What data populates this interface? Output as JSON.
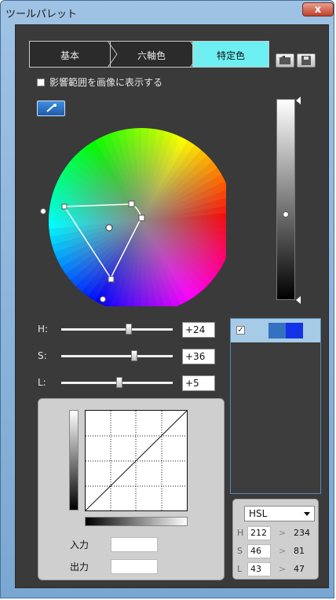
{
  "window": {
    "title": "ツールパレット",
    "close_symbol": "x"
  },
  "tabs": [
    {
      "label": "基本",
      "active": false
    },
    {
      "label": "六軸色",
      "active": false
    },
    {
      "label": "特定色",
      "active": true
    }
  ],
  "toolbar": {
    "load_icon": "folder-open-icon",
    "save_icon": "floppy-disk-icon"
  },
  "options": {
    "show_range_label": "影響範囲を画像に表示する",
    "show_range_checked": false,
    "eyedropper_icon": "eyedropper-icon"
  },
  "sliders": [
    {
      "label": "H:",
      "value": "+24"
    },
    {
      "label": "S:",
      "value": "+36"
    },
    {
      "label": "L:",
      "value": "+5"
    }
  ],
  "swatch_list": [
    {
      "checked": true,
      "before_color": "#3371c1",
      "after_color": "#1432e8"
    }
  ],
  "curve": {
    "input_label": "入力",
    "output_label": "出力",
    "input_value": "",
    "output_value": ""
  },
  "color_info": {
    "mode": "HSL",
    "rows": [
      {
        "channel": "H",
        "before": "212",
        "arrow": ">",
        "after": "234"
      },
      {
        "channel": "S",
        "before": "46",
        "arrow": ">",
        "after": "81"
      },
      {
        "channel": "L",
        "before": "43",
        "arrow": ">",
        "after": "47"
      }
    ]
  }
}
